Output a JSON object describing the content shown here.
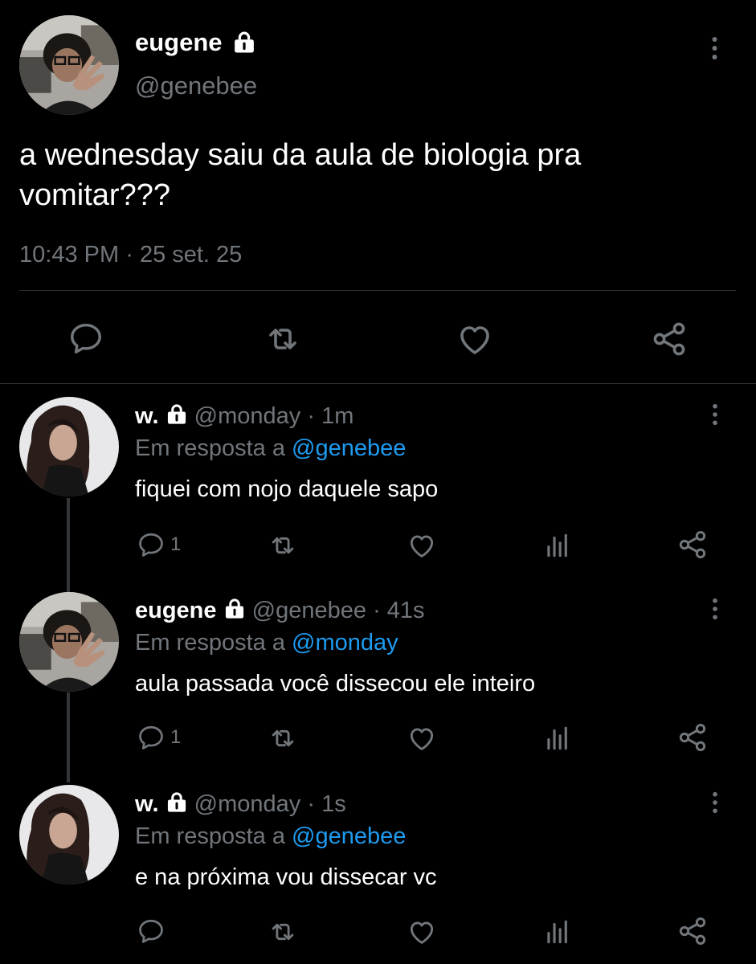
{
  "main_tweet": {
    "display_name": "eugene",
    "handle": "@genebee",
    "text": "a wednesday saiu da aula de biologia pra vomitar???",
    "time": "10:43 PM",
    "separator": "·",
    "date": "25 set. 25",
    "icons": [
      "more-icon",
      "lock-icon",
      "reply-icon",
      "retweet-icon",
      "like-icon",
      "share-icon"
    ]
  },
  "replies": [
    {
      "display_name": "w.",
      "handle": "@monday",
      "time_sep": "·",
      "time": "1m",
      "reply_prefix": "Em resposta a",
      "reply_to": "@genebee",
      "text": "fiquei com nojo daquele sapo",
      "reply_count": "1"
    },
    {
      "display_name": "eugene",
      "handle": "@genebee",
      "time_sep": "·",
      "time": "41s",
      "reply_prefix": "Em resposta a",
      "reply_to": "@monday",
      "text": "aula passada você dissecou ele inteiro",
      "reply_count": "1"
    },
    {
      "display_name": "w.",
      "handle": "@monday",
      "time_sep": "·",
      "time": "1s",
      "reply_prefix": "Em resposta a",
      "reply_to": "@genebee",
      "text": "e na próxima vou dissecar vc",
      "reply_count": ""
    }
  ],
  "colors": {
    "background": "#000000",
    "text": "#e7e9ea",
    "muted": "#71767b",
    "link": "#1d9bf0",
    "divider": "#2f3336"
  }
}
